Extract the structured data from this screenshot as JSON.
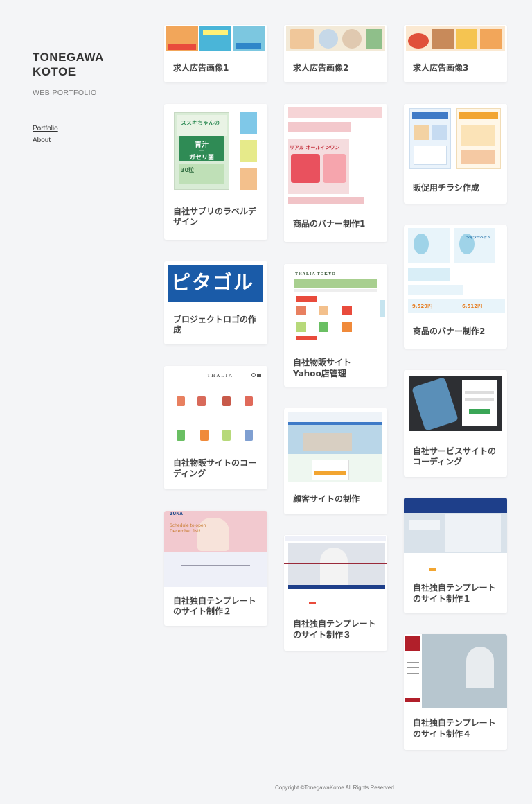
{
  "site": {
    "title": "TONEGAWA\nKOTOE",
    "subtitle": "WEB PORTFOLIO"
  },
  "nav": {
    "portfolio": "Portfolio",
    "about": "About"
  },
  "works": [
    {
      "title": "求人広告画像1"
    },
    {
      "title": "求人広告画像2"
    },
    {
      "title": "求人広告画像3"
    },
    {
      "title": "自社サプリのラベルデザイン",
      "thumb_text": [
        "ススキちゃんの",
        "青汁",
        "＋",
        "ガセリ菌",
        "30粒"
      ]
    },
    {
      "title": "商品のバナー制作1",
      "thumb_text": [
        "リアル オールインワン"
      ]
    },
    {
      "title": "販促用チラシ作成"
    },
    {
      "title": "プロジェクトロゴの作成",
      "thumb_text": "ピタゴル"
    },
    {
      "title": "自社物販サイトYahoo店管理",
      "thumb_text": "THALIA TOKYO"
    },
    {
      "title": "商品のバナー制作2",
      "thumb_text": [
        "シャワーヘッド",
        "9,529円",
        "6,512円"
      ]
    },
    {
      "title": "自社物販サイトのコーディング",
      "thumb_text": "THALIA"
    },
    {
      "title": "顧客サイトの制作"
    },
    {
      "title": "自社サービスサイトのコーディング"
    },
    {
      "title": "自社独自テンプレートのサイト制作２",
      "thumb_text": [
        "ZUNA",
        "Schedule to open",
        "December 1st!"
      ]
    },
    {
      "title": "自社独自テンプレートのサイト制作３"
    },
    {
      "title": "自社独自テンプレートのサイト制作１"
    },
    {
      "title": "自社独自テンプレートのサイト制作４"
    }
  ],
  "footer": "Copyright ©TonegawaKotoe All Rights Reserved."
}
